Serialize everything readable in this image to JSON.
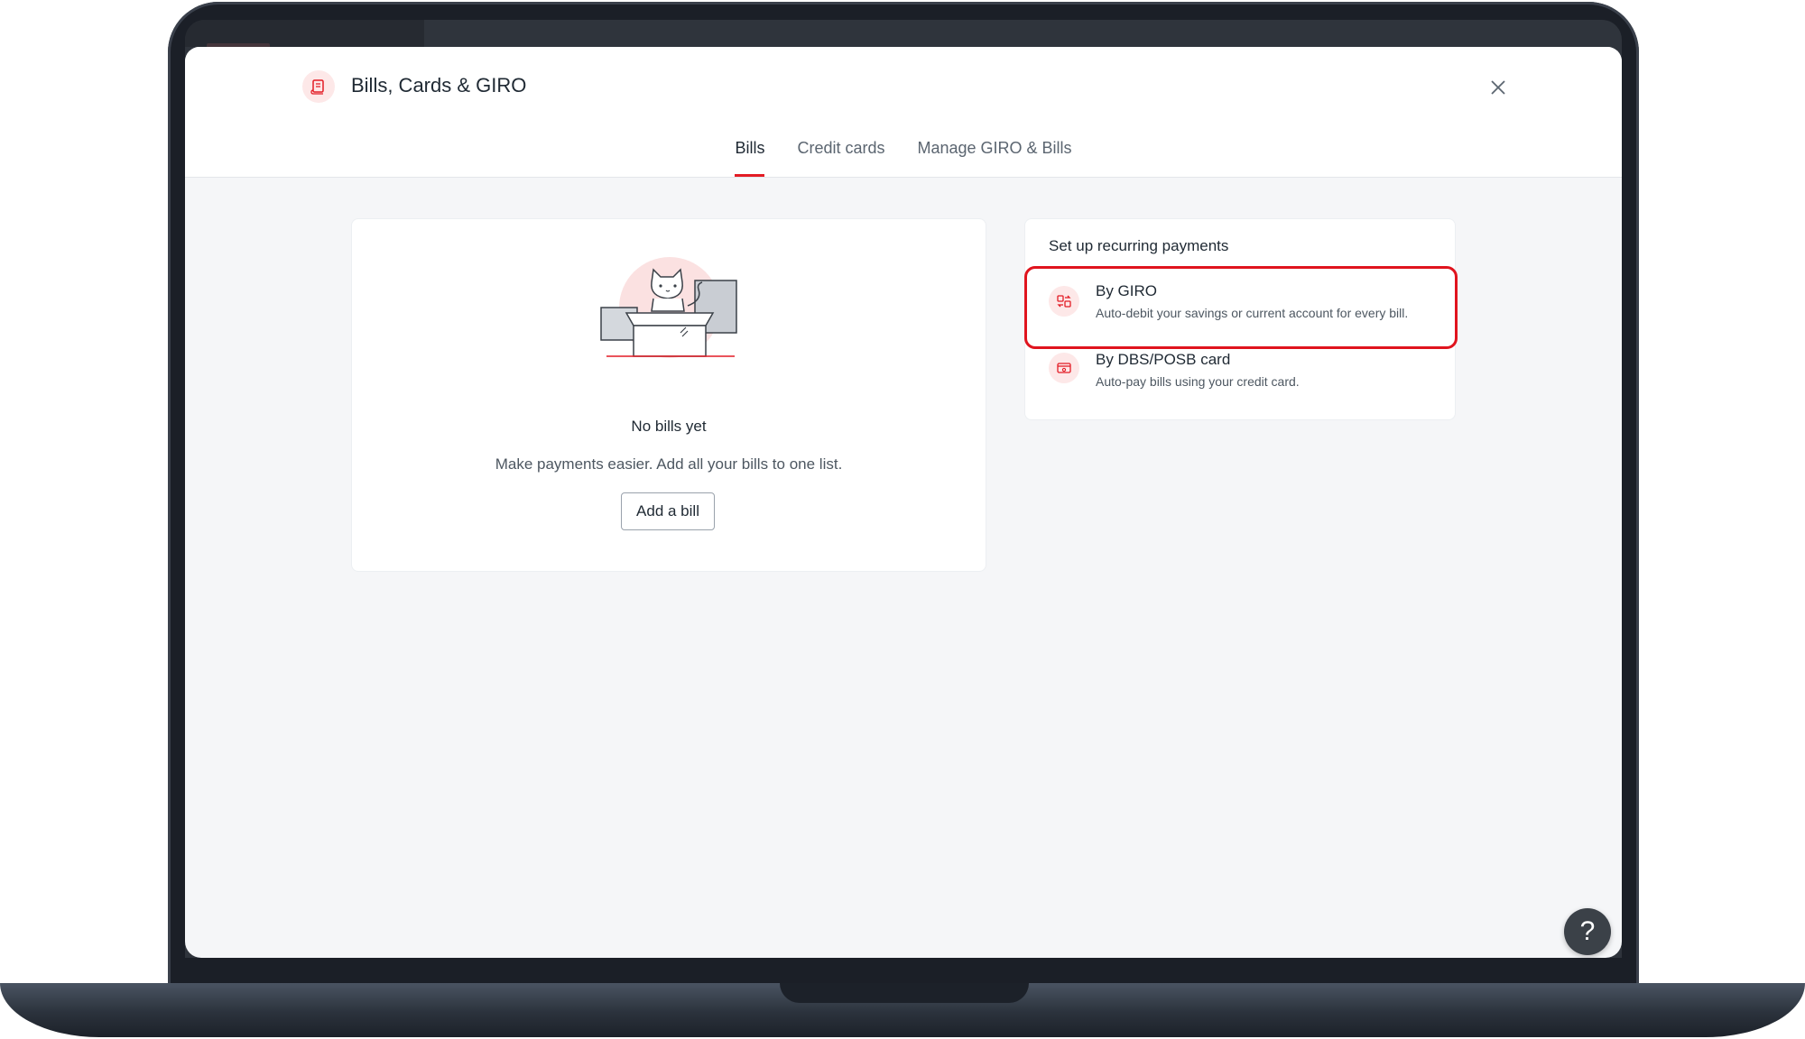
{
  "modal": {
    "title": "Bills, Cards & GIRO",
    "icon": "bill-scroll-icon",
    "close_icon": "close-icon"
  },
  "tabs": [
    {
      "label": "Bills",
      "active": true
    },
    {
      "label": "Credit cards",
      "active": false
    },
    {
      "label": "Manage GIRO & Bills",
      "active": false
    }
  ],
  "bills_empty": {
    "illustration": "cat-in-box-illustration",
    "title": "No bills yet",
    "description": "Make payments easier. Add all your bills to one list.",
    "button_label": "Add a bill"
  },
  "recurring": {
    "title": "Set up recurring payments",
    "options": [
      {
        "label": "By GIRO",
        "description": "Auto-debit your savings or current account for every bill.",
        "icon": "giro-transfer-icon",
        "highlighted": true
      },
      {
        "label": "By DBS/POSB card",
        "description": "Auto-pay bills using your credit card.",
        "icon": "credit-card-icon",
        "highlighted": false
      }
    ]
  },
  "help": {
    "label": "?",
    "icon": "help-icon"
  },
  "colors": {
    "accent": "#e31c25",
    "highlight": "#e0141e",
    "icon_bg": "#fde8e8",
    "page_bg": "#f5f6f8",
    "text": "#1f2933"
  }
}
